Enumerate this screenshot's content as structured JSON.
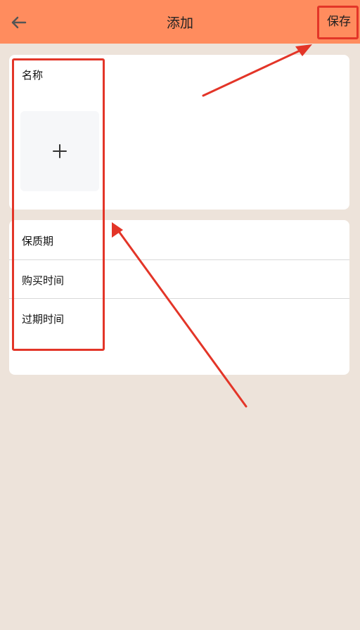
{
  "header": {
    "title": "添加",
    "save_label": "保存",
    "back_icon": "arrow-left-icon"
  },
  "form": {
    "name_label": "名称",
    "image_add_icon": "plus-icon",
    "fields": [
      {
        "label": "保质期"
      },
      {
        "label": "购买时间"
      },
      {
        "label": "过期时间"
      }
    ]
  },
  "colors": {
    "header_bg": "#ff8c5e",
    "page_bg": "#ede3da",
    "annotation_red": "#e33528"
  }
}
